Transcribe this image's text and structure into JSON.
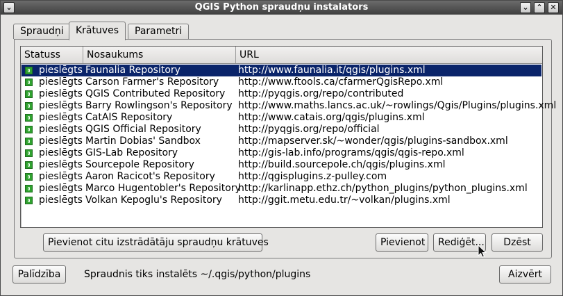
{
  "window": {
    "title": "QGIS Python spraudņu instalators",
    "menu_glyph": "⌄",
    "shade_glyph": "⌄",
    "maximize_glyph": "⌃",
    "close_glyph": "✕"
  },
  "tabs": [
    {
      "label": "Spraudņi",
      "active": false
    },
    {
      "label": "Krātuves",
      "active": true
    },
    {
      "label": "Parametri",
      "active": false
    }
  ],
  "table": {
    "columns": [
      "Statuss",
      "Nosaukums",
      "URL"
    ],
    "status_icon": "repository-connected-icon",
    "rows": [
      {
        "status": "pieslēgts",
        "name": "Faunalia Repository",
        "url": "http://www.faunalia.it/qgis/plugins.xml",
        "selected": true
      },
      {
        "status": "pieslēgts",
        "name": "Carson Farmer's Repository",
        "url": "http://www.ftools.ca/cfarmerQgisRepo.xml"
      },
      {
        "status": "pieslēgts",
        "name": "QGIS Contributed Repository",
        "url": "http://pyqgis.org/repo/contributed"
      },
      {
        "status": "pieslēgts",
        "name": "Barry Rowlingson's Repository",
        "url": "http://www.maths.lancs.ac.uk/~rowlings/Qgis/Plugins/plugins.xml"
      },
      {
        "status": "pieslēgts",
        "name": "CatAIS Repository",
        "url": "http://www.catais.org/qgis/plugins.xml"
      },
      {
        "status": "pieslēgts",
        "name": "QGIS Official Repository",
        "url": "http://pyqgis.org/repo/official"
      },
      {
        "status": "pieslēgts",
        "name": "Martin Dobias' Sandbox",
        "url": "http://mapserver.sk/~wonder/qgis/plugins-sandbox.xml"
      },
      {
        "status": "pieslēgts",
        "name": "GIS-Lab Repository",
        "url": "http://gis-lab.info/programs/qgis/qgis-repo.xml"
      },
      {
        "status": "pieslēgts",
        "name": "Sourcepole Repository",
        "url": "http://build.sourcepole.ch/qgis/plugins.xml"
      },
      {
        "status": "pieslēgts",
        "name": "Aaron Racicot's Repository",
        "url": "http://qgisplugins.z-pulley.com"
      },
      {
        "status": "pieslēgts",
        "name": "Marco Hugentobler's Repository",
        "url": "http://karlinapp.ethz.ch/python_plugins/python_plugins.xml"
      },
      {
        "status": "pieslēgts",
        "name": "Volkan Kepoglu's Repository",
        "url": "http://ggit.metu.edu.tr/~volkan/plugins.xml"
      }
    ]
  },
  "buttons": {
    "add_third_party": "Pievienot citu izstrādātāju spraudņu krātuves",
    "add": "Pievienot",
    "edit": "Rediģēt...",
    "delete": "Dzēst",
    "help": "Palīdzība",
    "close": "Aizvērt"
  },
  "footer": {
    "status_text": "Spraudnis tiks instalēts ~/.qgis/python/plugins"
  },
  "colors": {
    "selection": "#0a246a",
    "titlebar": "#4a4a4a",
    "status_icon": "#2fa12f"
  }
}
